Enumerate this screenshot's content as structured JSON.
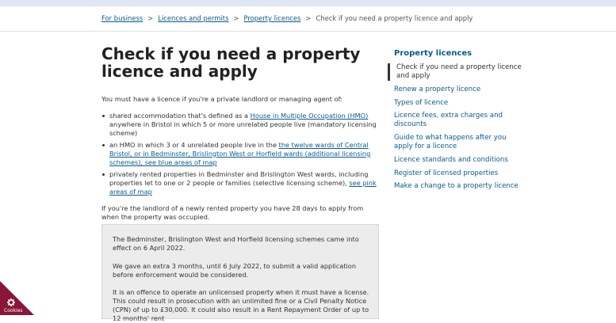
{
  "breadcrumb": {
    "items": [
      "For business",
      "Licences and permits",
      "Property licences"
    ],
    "current": "Check if you need a property licence and apply"
  },
  "page_title": "Check if you need a property licence and apply",
  "intro": "You must have a licence if you're a private landlord or managing agent of:",
  "bullets": [
    {
      "pre": "shared accommodation that's defined as a ",
      "link": "House in Multiple Occupation (HMO)",
      "post": " anywhere in Bristol in which 5 or more unrelated people live (mandatory licensing scheme)"
    },
    {
      "pre": "an HMO in which 3 or 4 unrelated people live in the ",
      "link": "the twelve wards of Central Bristol, or in Bedminster, Brislington West or Horfield wards (additional licensing schemes), see blue areas of map",
      "post": ""
    },
    {
      "pre": "privately rented properties in Bedminster and Brislington West wards, including properties let to one or 2 people or families (selective licensing scheme), ",
      "link": "see pink areas of map",
      "post": ""
    }
  ],
  "landlord_note": "If you're the landlord of a newly rented property you have 28 days to apply from when the property was occupied.",
  "callout": {
    "p1": "The Bedminster, Brislington West and Horfield licensing schemes came into effect on 6 April 2022.",
    "p2": "We gave an extra 3 months, until 6 July 2022, to submit a valid application before enforcement would be considered.",
    "p3": "It is an offence to operate an unlicensed property when it must have a license.  This could result in prosecution with an unlimited fine or a Civil Penalty Notice (CPN) of up to £30,000.  It could also result in a Rent Repayment Order of up to 12 months' rent"
  },
  "sidebar": {
    "title": "Property licences",
    "current": "Check if you need a property licence and apply",
    "items": [
      "Renew a property licence",
      "Types of licence",
      "Licence fees, extra charges and discounts",
      "Guide to what happens after you apply for a licence",
      "Licence standards and conditions",
      "Register of licensed properties",
      "Make a change to a property licence"
    ]
  },
  "cookie_label": "Cookies",
  "colors": {
    "link": "#0b5a8e",
    "cookie": "#8a1538",
    "topbar": "#dfe7f2"
  }
}
